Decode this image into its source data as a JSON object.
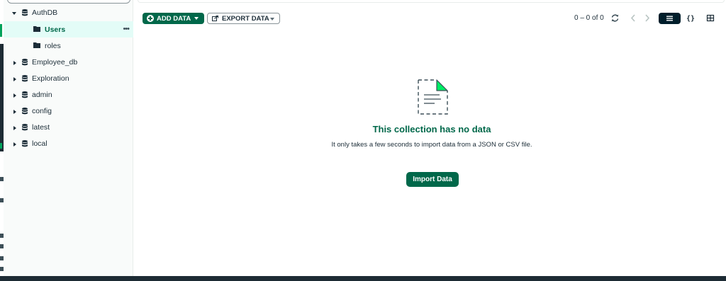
{
  "sidebar": {
    "databases": [
      {
        "name": "AuthDB",
        "expanded": true
      },
      {
        "name": "Employee_db",
        "expanded": false
      },
      {
        "name": "Exploration",
        "expanded": false
      },
      {
        "name": "admin",
        "expanded": false
      },
      {
        "name": "config",
        "expanded": false
      },
      {
        "name": "latest",
        "expanded": false
      },
      {
        "name": "local",
        "expanded": false
      }
    ],
    "collections": [
      {
        "name": "Users",
        "active": true
      },
      {
        "name": "roles",
        "active": false
      }
    ],
    "more_icon": "ellipsis-icon"
  },
  "toolbar": {
    "add_data_label": "ADD DATA",
    "export_data_label": "EXPORT DATA",
    "pagination": "0 – 0 of 0",
    "json_view_glyph": "{}"
  },
  "empty_state": {
    "title": "This collection has no data",
    "description": "It only takes a few seconds to import data from a JSON or CSV file.",
    "import_button_label": "Import Data"
  },
  "colors": {
    "brand_green": "#00684a",
    "accent_green": "#00ed64",
    "active_row_bg": "#e3fcf7",
    "dark": "#001e2b"
  }
}
